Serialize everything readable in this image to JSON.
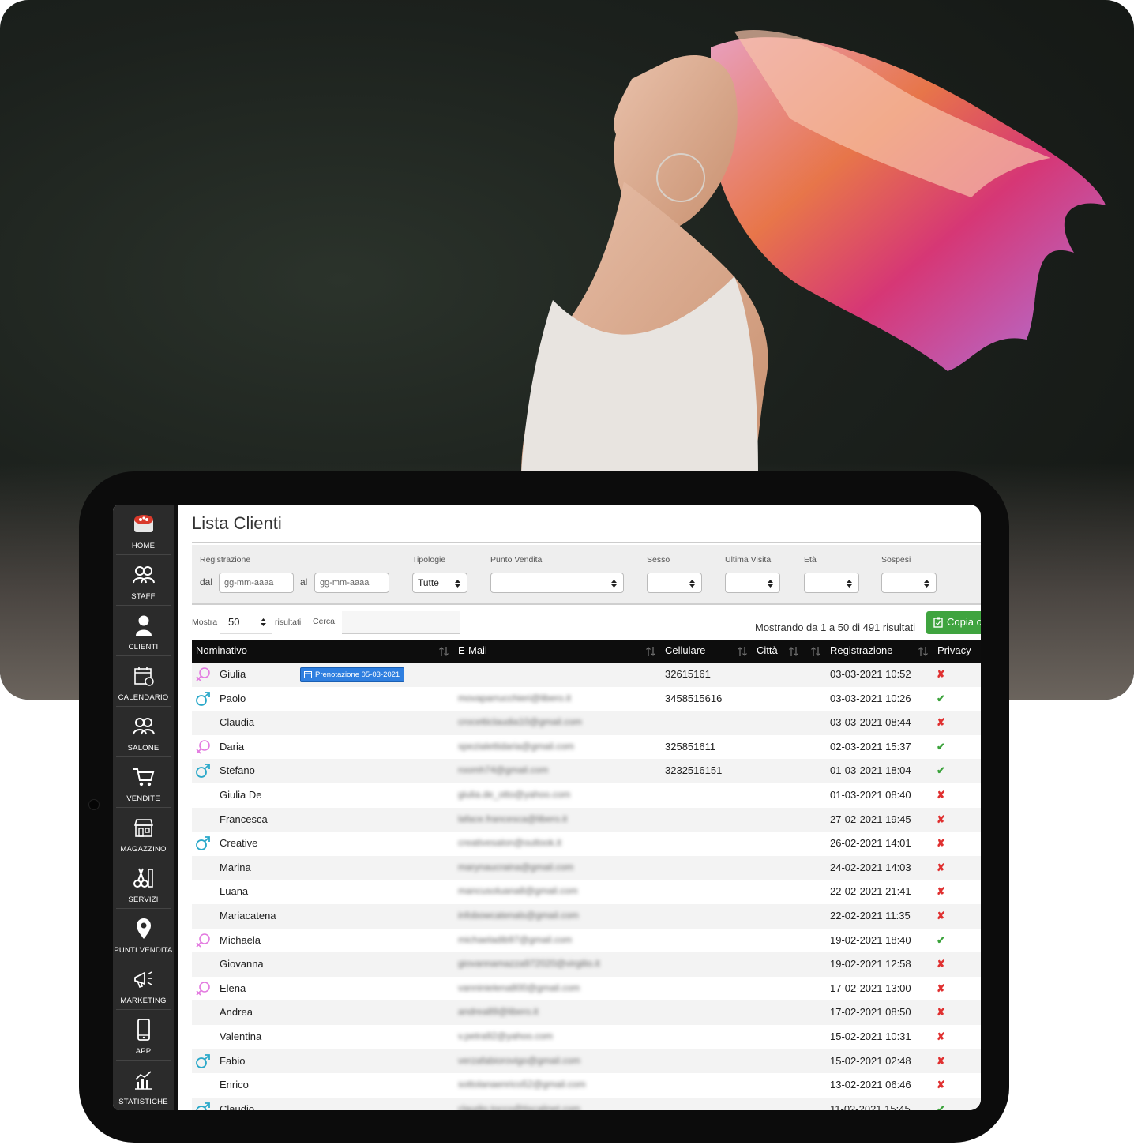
{
  "sidebar": {
    "items": [
      {
        "label": "HOME",
        "icon": "logo-icon"
      },
      {
        "label": "STAFF",
        "icon": "staff-icon"
      },
      {
        "label": "CLIENTI",
        "icon": "user-icon"
      },
      {
        "label": "CALENDARIO",
        "icon": "calendar-icon"
      },
      {
        "label": "SALONE",
        "icon": "salon-icon"
      },
      {
        "label": "VENDITE",
        "icon": "cart-icon"
      },
      {
        "label": "MAGAZZINO",
        "icon": "store-icon"
      },
      {
        "label": "SERVIZI",
        "icon": "scissors-icon"
      },
      {
        "label": "PUNTI VENDITA",
        "icon": "map-pin-icon"
      },
      {
        "label": "MARKETING",
        "icon": "megaphone-icon"
      },
      {
        "label": "APP",
        "icon": "phone-icon"
      },
      {
        "label": "STATISTICHE",
        "icon": "chart-icon"
      }
    ]
  },
  "page": {
    "title": "Lista Clienti"
  },
  "filters": {
    "registrazione_label": "Registrazione",
    "dal_label": "dal",
    "al_label": "al",
    "date_placeholder": "gg-mm-aaaa",
    "tipologie_label": "Tipologie",
    "tipologie_value": "Tutte",
    "punto_vendita_label": "Punto Vendita",
    "sesso_label": "Sesso",
    "ultima_visita_label": "Ultima Visita",
    "eta_label": "Età",
    "sospesi_label": "Sospesi"
  },
  "table_controls": {
    "mostra_label": "Mostra",
    "page_length": "50",
    "risultati_label": "risultati",
    "cerca_label": "Cerca:",
    "info": "Mostrando da 1 a 50 di 491 risultati",
    "copy_button": "Copia c"
  },
  "columns": {
    "nominativo": "Nominativo",
    "email": "E-Mail",
    "cellulare": "Cellulare",
    "citta": "Città",
    "registrazione": "Registrazione",
    "privacy": "Privacy"
  },
  "badge_text": "Prenotazione 05-03-2021",
  "privacy_yes": "✔",
  "privacy_no": "✘",
  "colors": {
    "female": "#e37ae0",
    "male": "#29a8c9",
    "badge": "#2f7fe0",
    "copy_button": "#3fa43f"
  },
  "rows": [
    {
      "name": "Giulia",
      "gender": "f",
      "email": "",
      "phone": "32615161",
      "reg": "03-03-2021 10:52",
      "privacy": false,
      "badge": true
    },
    {
      "name": "Paolo",
      "gender": "m",
      "email": "movaparrucchieri@libero.it",
      "phone": "3458515616",
      "reg": "03-03-2021 10:26",
      "privacy": true
    },
    {
      "name": "Claudia",
      "gender": "",
      "email": "crocetticlaudia10@gmail.com",
      "phone": "",
      "reg": "03-03-2021 08:44",
      "privacy": false
    },
    {
      "name": "Daria",
      "gender": "f",
      "email": "spezialettidaria@gmail.com",
      "phone": "325851611",
      "reg": "02-03-2021 15:37",
      "privacy": true
    },
    {
      "name": "Stefano",
      "gender": "m",
      "email": "roomh74@gmail.com",
      "phone": "3232516151",
      "reg": "01-03-2021 18:04",
      "privacy": true
    },
    {
      "name": "Giulia De",
      "gender": "",
      "email": "giulia.de_otto@yahoo.com",
      "phone": "",
      "reg": "01-03-2021 08:40",
      "privacy": false
    },
    {
      "name": "Francesca",
      "gender": "",
      "email": "laface.francesca@libero.it",
      "phone": "",
      "reg": "27-02-2021 19:45",
      "privacy": false
    },
    {
      "name": "Creative",
      "gender": "m",
      "email": "creativesalon@outlook.it",
      "phone": "",
      "reg": "26-02-2021 14:01",
      "privacy": false
    },
    {
      "name": "Marina",
      "gender": "",
      "email": "marynaucraina@gmail.com",
      "phone": "",
      "reg": "24-02-2021 14:03",
      "privacy": false
    },
    {
      "name": "Luana",
      "gender": "",
      "email": "mancusoluana8@gmail.com",
      "phone": "",
      "reg": "22-02-2021 21:41",
      "privacy": false
    },
    {
      "name": "Mariacatena",
      "gender": "",
      "email": "infobowcatenals@gmail.com",
      "phone": "",
      "reg": "22-02-2021 11:35",
      "privacy": false
    },
    {
      "name": "Michaela",
      "gender": "f",
      "email": "michaeladib97@gmail.com",
      "phone": "",
      "reg": "19-02-2021 18:40",
      "privacy": true
    },
    {
      "name": "Giovanna",
      "gender": "",
      "email": "giovannamazza972020@virgilio.it",
      "phone": "",
      "reg": "19-02-2021 12:58",
      "privacy": false
    },
    {
      "name": "Elena",
      "gender": "f",
      "email": "vanninielena800@gmail.com",
      "phone": "",
      "reg": "17-02-2021 13:00",
      "privacy": false
    },
    {
      "name": "Andrea",
      "gender": "",
      "email": "andrea89@libero.it",
      "phone": "",
      "reg": "17-02-2021 08:50",
      "privacy": false
    },
    {
      "name": "Valentina",
      "gender": "",
      "email": "v.petra92@yahoo.com",
      "phone": "",
      "reg": "15-02-2021 10:31",
      "privacy": false
    },
    {
      "name": "Fabio",
      "gender": "m",
      "email": "verzafabiorovigo@gmail.com",
      "phone": "",
      "reg": "15-02-2021 02:48",
      "privacy": false
    },
    {
      "name": "Enrico",
      "gender": "",
      "email": "sottolanaenrico52@gmail.com",
      "phone": "",
      "reg": "13-02-2021 06:46",
      "privacy": false
    },
    {
      "name": "Claudio",
      "gender": "m",
      "email": "claudio.tocco@tiscalinet.com",
      "phone": "",
      "reg": "11-02-2021 15:45",
      "privacy": true
    }
  ]
}
